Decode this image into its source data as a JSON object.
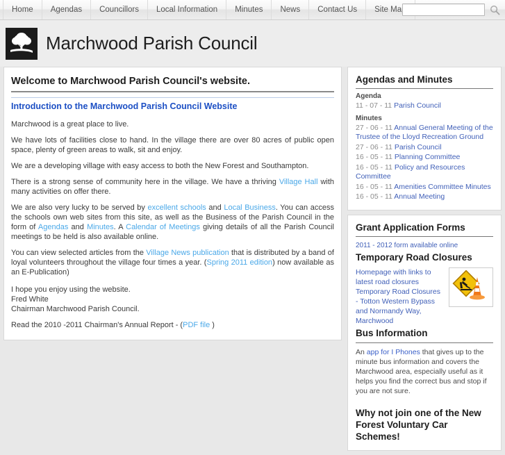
{
  "nav": {
    "items": [
      {
        "label": "Home",
        "name": "nav-item-home"
      },
      {
        "label": "Agendas",
        "name": "nav-item-agendas"
      },
      {
        "label": "Councillors",
        "name": "nav-item-councillors"
      },
      {
        "label": "Local Information",
        "name": "nav-item-local-information"
      },
      {
        "label": "Minutes",
        "name": "nav-item-minutes"
      },
      {
        "label": "News",
        "name": "nav-item-news"
      },
      {
        "label": "Contact Us",
        "name": "nav-item-contact-us"
      },
      {
        "label": "Site Map",
        "name": "nav-item-site-map"
      }
    ]
  },
  "search": {
    "value": "",
    "placeholder": "",
    "icon": "search-icon"
  },
  "masthead": {
    "title": "Marchwood Parish Council",
    "logo_icon": "tree-logo-icon"
  },
  "main": {
    "welcome_heading": "Welcome to Marchwood Parish Council's website.",
    "intro_heading": "Introduction to the Marchwood Parish Council Website",
    "p1": "Marchwood is a great place to live.",
    "p2": "We have lots of facilities close to hand. In the village there are over 80 acres of public open space, plenty of green areas to walk, sit and enjoy.",
    "p3": "We are a developing village with easy access to both the New Forest and Southampton.",
    "p4_a": "There is a strong sense of community here in the village. We have a thriving ",
    "p4_link": "Village Hall",
    "p4_b": " with many activities on offer there.",
    "p5_a": "We are also very lucky to be served by ",
    "p5_link1": "excellent schools",
    "p5_b": " and ",
    "p5_link2": "Local Business",
    "p5_c": ". You can access the schools own web sites from this site, as well as the Business of the Parish Council in the form of ",
    "p5_link3": "Agendas",
    "p5_d": " and ",
    "p5_link4": "Minutes",
    "p5_e": ". A ",
    "p5_link5": "Calendar of Meetings",
    "p5_f": " giving details of all the Parish Council meetings to be held is also available online.",
    "p6_a": "You can view selected articles from the ",
    "p6_link1": "Village News publication",
    "p6_b": " that is distributed by a band of loyal volunteers throughout the village four times a year. (",
    "p6_link2": "Spring 2011 edition",
    "p6_c": ") now available as an E-Publication)",
    "sig1": "I hope you enjoy using the website.",
    "sig2": "Fred White",
    "sig3": "Chairman Marchwood Parish Council.",
    "report_a": "Read the 2010 -2011 Chairman's Annual Report - (",
    "report_link": "PDF file",
    "report_b": " )"
  },
  "sidebar": {
    "agendas": {
      "heading": "Agendas and Minutes",
      "agenda_label": "Agenda",
      "agenda_items": [
        {
          "date": "11 - 07 - 11",
          "title": "Parish Council"
        }
      ],
      "minutes_label": "Minutes",
      "minutes_items": [
        {
          "date": "27 - 06 - 11",
          "title": "Annual General Meeting of the Trustee of the Lloyd Recreation Ground"
        },
        {
          "date": "27 - 06 - 11",
          "title": "Parish Council"
        },
        {
          "date": "16 - 05 - 11",
          "title": "Planning Committee"
        },
        {
          "date": "16 - 05 - 11",
          "title": "Policy and Resources Committee"
        },
        {
          "date": "16 - 05 - 11",
          "title": "Amenities Committee Minutes"
        },
        {
          "date": "16 - 05 - 11",
          "title": "Annual Meeting"
        }
      ]
    },
    "grants": {
      "heading": "Grant Application Forms",
      "link": "2011 - 2012 form available online"
    },
    "closures": {
      "heading": "Temporary Road Closures",
      "links": [
        "Homepage with links to latest road closures",
        "Temporary Road Closures - Totton Western Bypass and Normandy Way, Marchwood"
      ],
      "image_icon": "roadworks-sign-icon"
    },
    "bus": {
      "heading": "Bus Information",
      "text_a": "An ",
      "link": "app for I Phones",
      "text_b": " that gives up to the minute bus information and covers the Marchwood area, especially useful as it helps you find the correct bus and stop if you are not sure."
    },
    "car_scheme": {
      "heading": "Why not join one of the New Forest Voluntary Car Schemes!"
    }
  },
  "colors": {
    "link_light": "#4aa8e8",
    "link_blue": "#4160b8",
    "heading_blue": "#1c4fc4",
    "page_bg": "#e8e8e8"
  }
}
